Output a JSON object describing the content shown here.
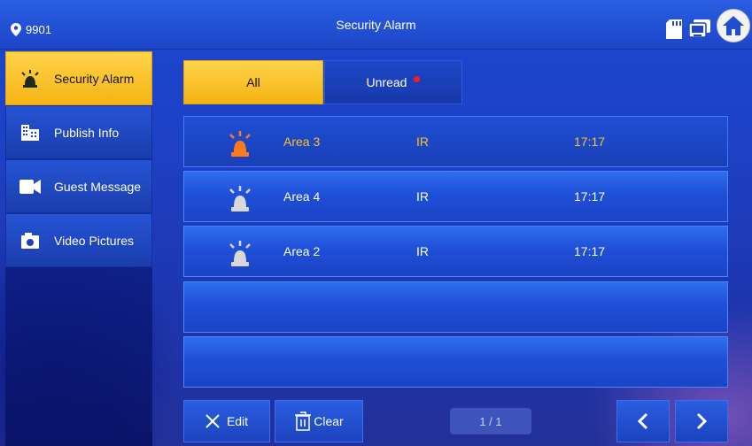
{
  "header": {
    "location_number": "9901",
    "title": "Security Alarm"
  },
  "sidebar": {
    "items": [
      {
        "label": "Security Alarm",
        "icon": "alarm-light-icon",
        "active": true
      },
      {
        "label": "Publish Info",
        "icon": "building-icon",
        "active": false
      },
      {
        "label": "Guest Message",
        "icon": "video-camera-icon",
        "active": false
      },
      {
        "label": "Video Pictures",
        "icon": "camera-icon",
        "active": false
      }
    ]
  },
  "tabs": {
    "all_label": "All",
    "unread_label": "Unread"
  },
  "alarms": [
    {
      "area": "Area 3",
      "type": "IR",
      "time": "17:17",
      "selected": true
    },
    {
      "area": "Area 4",
      "type": "IR",
      "time": "17:17",
      "selected": false
    },
    {
      "area": "Area 2",
      "type": "IR",
      "time": "17:17",
      "selected": false
    }
  ],
  "footer": {
    "edit_label": "Edit",
    "clear_label": "Clear",
    "page_indicator": "1 / 1"
  },
  "colors": {
    "accent_yellow": "#f5b414",
    "selected_text": "#ffc21a",
    "unread_dot": "#ff1a1a",
    "alarm_active": "#ff7a1a"
  }
}
